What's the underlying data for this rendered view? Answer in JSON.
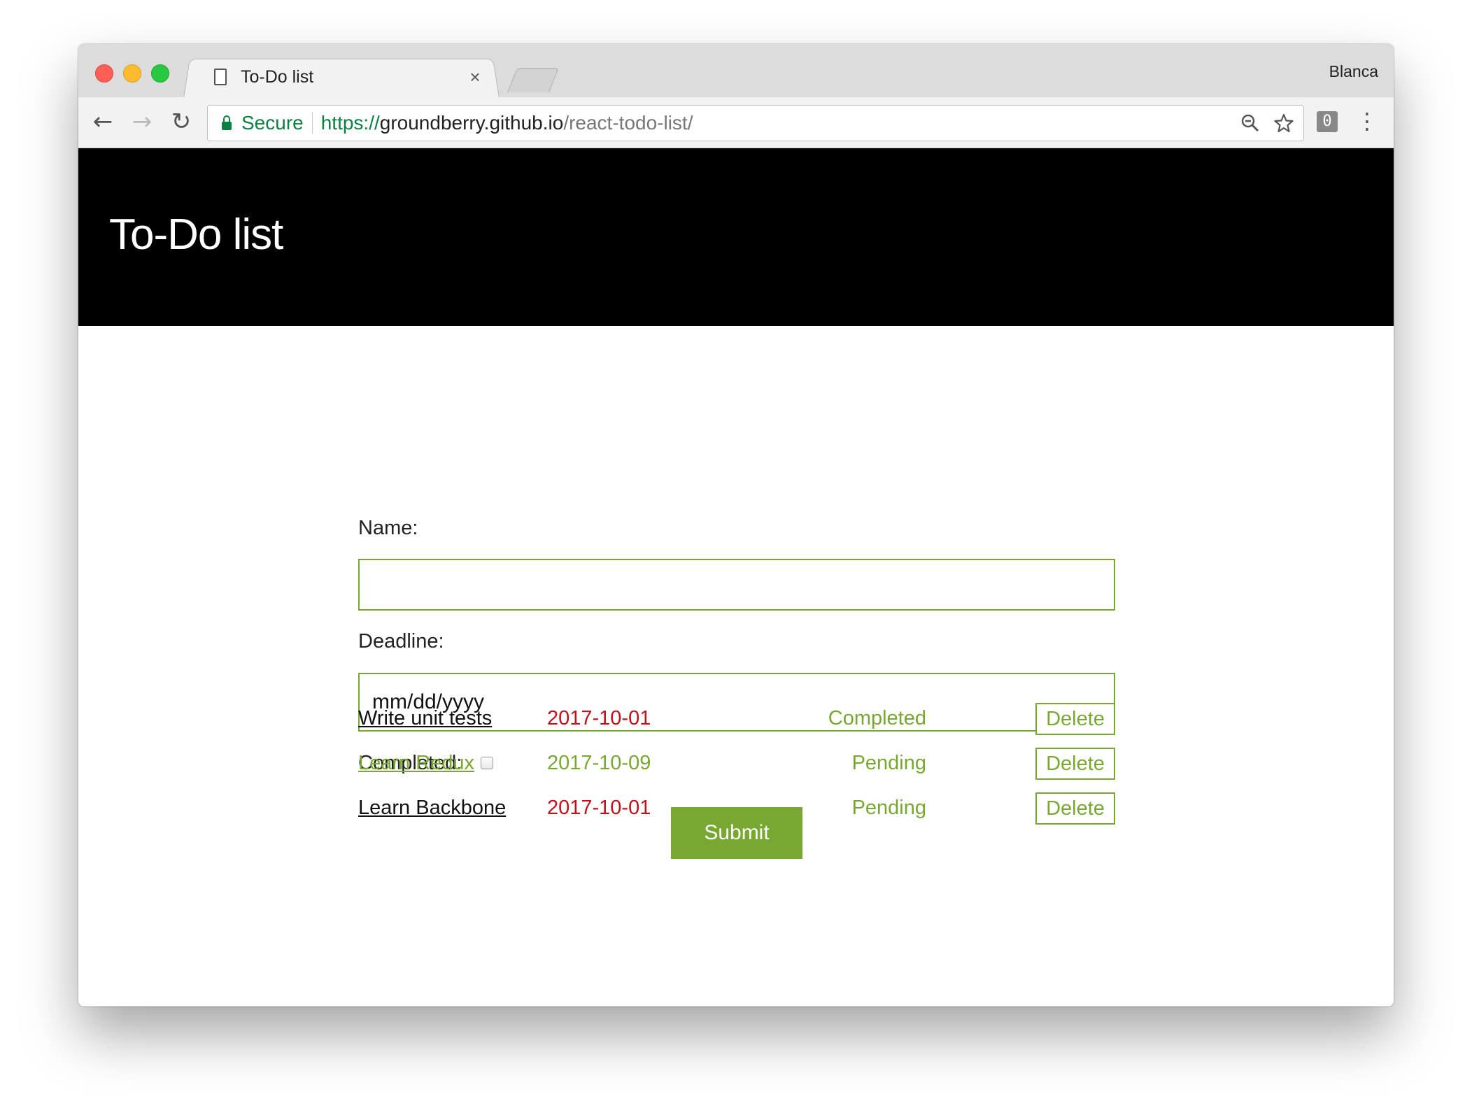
{
  "browser": {
    "tab_title": "To-Do list",
    "tab_close": "×",
    "profile_name": "Blanca",
    "secure_label": "Secure",
    "url_scheme": "https://",
    "url_host": "groundberry.github.io",
    "url_path": "/react-todo-list/",
    "extension_badge": "0",
    "icons": [
      "back-arrow-icon",
      "forward-arrow-icon",
      "reload-icon",
      "lock-icon",
      "zoom-icon",
      "star-icon",
      "extension-icon",
      "kebab-menu-icon"
    ]
  },
  "page": {
    "title": "To-Do list"
  },
  "form": {
    "name_label": "Name:",
    "name_value": "",
    "deadline_label": "Deadline:",
    "deadline_placeholder": "mm/dd/yyyy",
    "completed_label": "Completed:",
    "completed_checked": false,
    "submit_label": "Submit"
  },
  "todos": [
    {
      "name": "Write unit tests",
      "deadline": "2017-10-01",
      "status": "Completed",
      "delete_label": "Delete"
    },
    {
      "name": "Learn Redux",
      "deadline": "2017-10-09",
      "status": "Pending",
      "delete_label": "Delete"
    },
    {
      "name": "Learn Backbone",
      "deadline": "2017-10-01",
      "status": "Pending",
      "delete_label": "Delete"
    }
  ],
  "colors": {
    "accent_green": "#78a832",
    "overdue_red": "#c0101a",
    "header_bg": "#000000",
    "secure_green": "#0b8043"
  }
}
